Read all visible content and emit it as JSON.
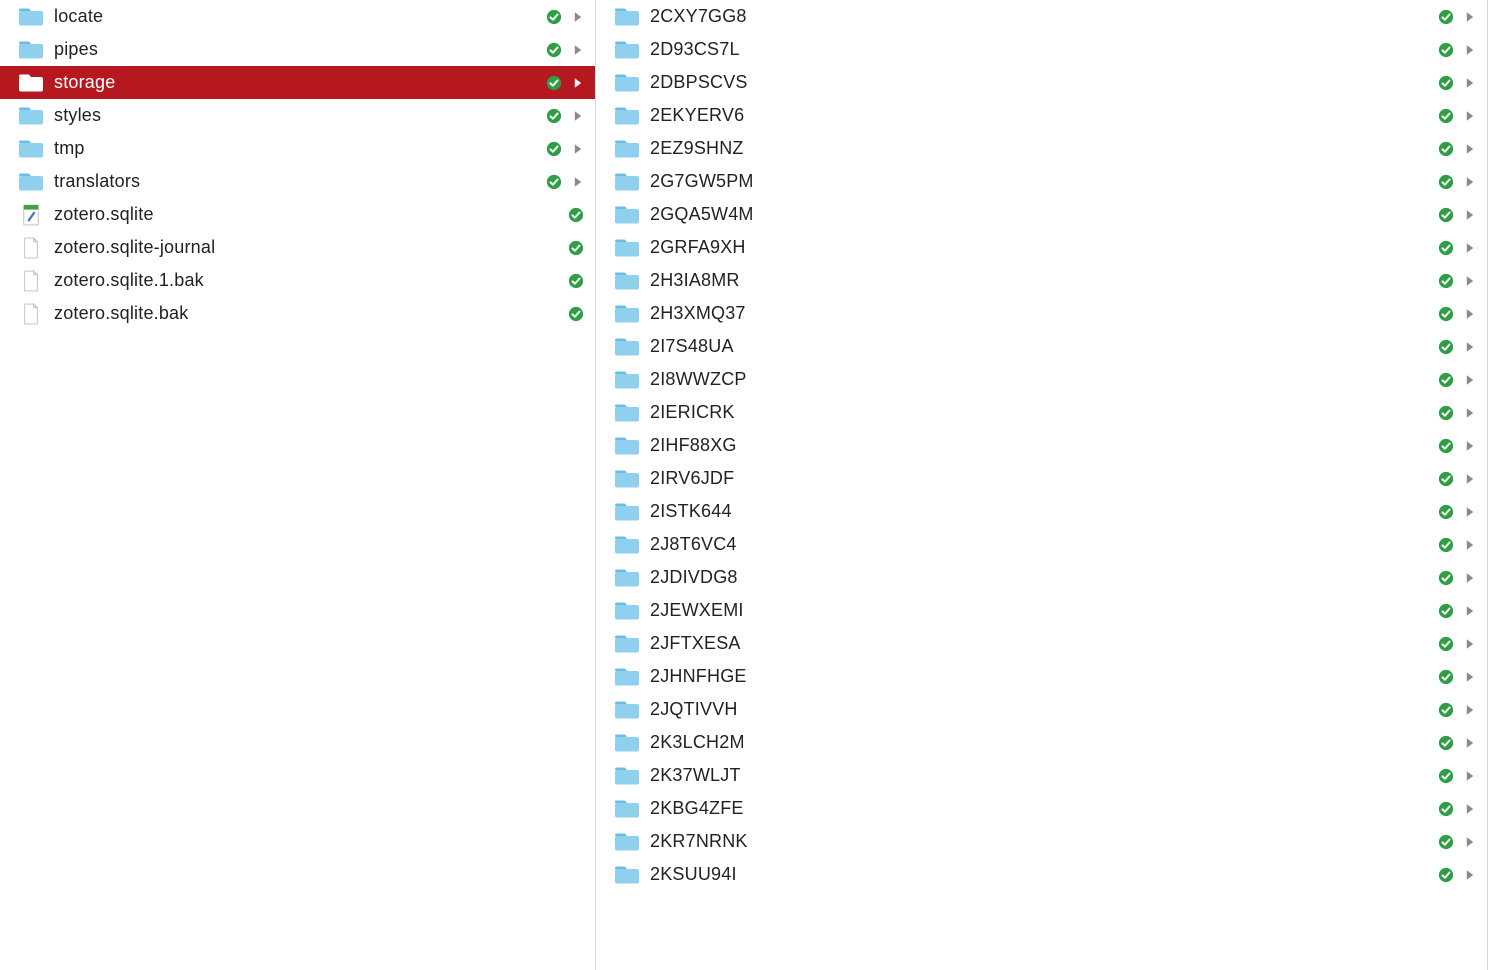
{
  "left_column": {
    "items": [
      {
        "name": "locate",
        "kind": "folder",
        "synced": true,
        "hasChildren": true,
        "selected": false
      },
      {
        "name": "pipes",
        "kind": "folder",
        "synced": true,
        "hasChildren": true,
        "selected": false
      },
      {
        "name": "storage",
        "kind": "folder",
        "synced": true,
        "hasChildren": true,
        "selected": true
      },
      {
        "name": "styles",
        "kind": "folder",
        "synced": true,
        "hasChildren": true,
        "selected": false
      },
      {
        "name": "tmp",
        "kind": "folder",
        "synced": true,
        "hasChildren": true,
        "selected": false
      },
      {
        "name": "translators",
        "kind": "folder",
        "synced": true,
        "hasChildren": true,
        "selected": false
      },
      {
        "name": "zotero.sqlite",
        "kind": "sqlite",
        "synced": true,
        "hasChildren": false,
        "selected": false
      },
      {
        "name": "zotero.sqlite-journal",
        "kind": "file",
        "synced": true,
        "hasChildren": false,
        "selected": false
      },
      {
        "name": "zotero.sqlite.1.bak",
        "kind": "file",
        "synced": true,
        "hasChildren": false,
        "selected": false
      },
      {
        "name": "zotero.sqlite.bak",
        "kind": "file",
        "synced": true,
        "hasChildren": false,
        "selected": false
      }
    ]
  },
  "right_column": {
    "items": [
      {
        "name": "2CXY7GG8",
        "kind": "folder",
        "synced": true,
        "hasChildren": true
      },
      {
        "name": "2D93CS7L",
        "kind": "folder",
        "synced": true,
        "hasChildren": true
      },
      {
        "name": "2DBPSCVS",
        "kind": "folder",
        "synced": true,
        "hasChildren": true
      },
      {
        "name": "2EKYERV6",
        "kind": "folder",
        "synced": true,
        "hasChildren": true
      },
      {
        "name": "2EZ9SHNZ",
        "kind": "folder",
        "synced": true,
        "hasChildren": true
      },
      {
        "name": "2G7GW5PM",
        "kind": "folder",
        "synced": true,
        "hasChildren": true
      },
      {
        "name": "2GQA5W4M",
        "kind": "folder",
        "synced": true,
        "hasChildren": true
      },
      {
        "name": "2GRFA9XH",
        "kind": "folder",
        "synced": true,
        "hasChildren": true
      },
      {
        "name": "2H3IA8MR",
        "kind": "folder",
        "synced": true,
        "hasChildren": true
      },
      {
        "name": "2H3XMQ37",
        "kind": "folder",
        "synced": true,
        "hasChildren": true
      },
      {
        "name": "2I7S48UA",
        "kind": "folder",
        "synced": true,
        "hasChildren": true
      },
      {
        "name": "2I8WWZCP",
        "kind": "folder",
        "synced": true,
        "hasChildren": true
      },
      {
        "name": "2IERICRK",
        "kind": "folder",
        "synced": true,
        "hasChildren": true
      },
      {
        "name": "2IHF88XG",
        "kind": "folder",
        "synced": true,
        "hasChildren": true
      },
      {
        "name": "2IRV6JDF",
        "kind": "folder",
        "synced": true,
        "hasChildren": true
      },
      {
        "name": "2ISTK644",
        "kind": "folder",
        "synced": true,
        "hasChildren": true
      },
      {
        "name": "2J8T6VC4",
        "kind": "folder",
        "synced": true,
        "hasChildren": true
      },
      {
        "name": "2JDIVDG8",
        "kind": "folder",
        "synced": true,
        "hasChildren": true
      },
      {
        "name": "2JEWXEMI",
        "kind": "folder",
        "synced": true,
        "hasChildren": true
      },
      {
        "name": "2JFTXESA",
        "kind": "folder",
        "synced": true,
        "hasChildren": true
      },
      {
        "name": "2JHNFHGE",
        "kind": "folder",
        "synced": true,
        "hasChildren": true
      },
      {
        "name": "2JQTIVVH",
        "kind": "folder",
        "synced": true,
        "hasChildren": true
      },
      {
        "name": "2K3LCH2M",
        "kind": "folder",
        "synced": true,
        "hasChildren": true
      },
      {
        "name": "2K37WLJT",
        "kind": "folder",
        "synced": true,
        "hasChildren": true
      },
      {
        "name": "2KBG4ZFE",
        "kind": "folder",
        "synced": true,
        "hasChildren": true
      },
      {
        "name": "2KR7NRNK",
        "kind": "folder",
        "synced": true,
        "hasChildren": true
      },
      {
        "name": "2KSUU94I",
        "kind": "folder",
        "synced": true,
        "hasChildren": true
      }
    ]
  }
}
